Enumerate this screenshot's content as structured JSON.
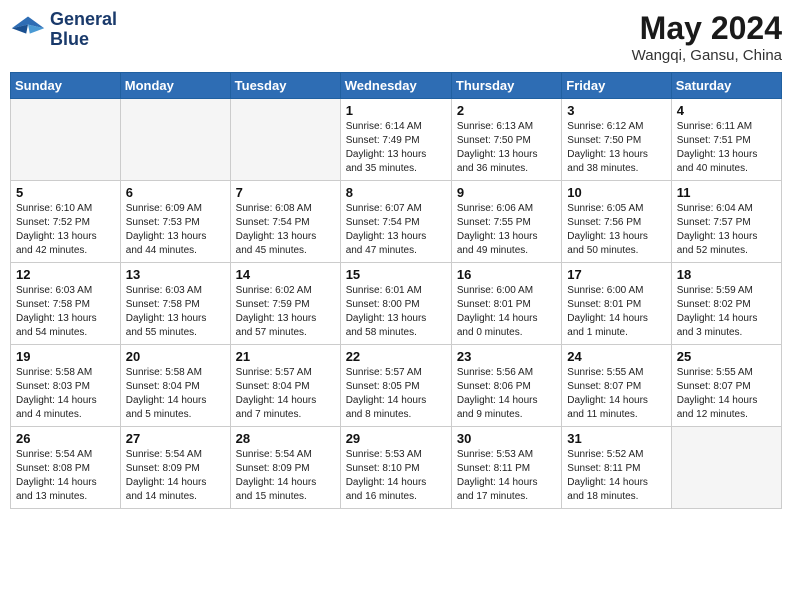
{
  "header": {
    "logo_line1": "General",
    "logo_line2": "Blue",
    "month_year": "May 2024",
    "location": "Wangqi, Gansu, China"
  },
  "days_of_week": [
    "Sunday",
    "Monday",
    "Tuesday",
    "Wednesday",
    "Thursday",
    "Friday",
    "Saturday"
  ],
  "weeks": [
    [
      {
        "day": "",
        "info": ""
      },
      {
        "day": "",
        "info": ""
      },
      {
        "day": "",
        "info": ""
      },
      {
        "day": "1",
        "info": "Sunrise: 6:14 AM\nSunset: 7:49 PM\nDaylight: 13 hours\nand 35 minutes."
      },
      {
        "day": "2",
        "info": "Sunrise: 6:13 AM\nSunset: 7:50 PM\nDaylight: 13 hours\nand 36 minutes."
      },
      {
        "day": "3",
        "info": "Sunrise: 6:12 AM\nSunset: 7:50 PM\nDaylight: 13 hours\nand 38 minutes."
      },
      {
        "day": "4",
        "info": "Sunrise: 6:11 AM\nSunset: 7:51 PM\nDaylight: 13 hours\nand 40 minutes."
      }
    ],
    [
      {
        "day": "5",
        "info": "Sunrise: 6:10 AM\nSunset: 7:52 PM\nDaylight: 13 hours\nand 42 minutes."
      },
      {
        "day": "6",
        "info": "Sunrise: 6:09 AM\nSunset: 7:53 PM\nDaylight: 13 hours\nand 44 minutes."
      },
      {
        "day": "7",
        "info": "Sunrise: 6:08 AM\nSunset: 7:54 PM\nDaylight: 13 hours\nand 45 minutes."
      },
      {
        "day": "8",
        "info": "Sunrise: 6:07 AM\nSunset: 7:54 PM\nDaylight: 13 hours\nand 47 minutes."
      },
      {
        "day": "9",
        "info": "Sunrise: 6:06 AM\nSunset: 7:55 PM\nDaylight: 13 hours\nand 49 minutes."
      },
      {
        "day": "10",
        "info": "Sunrise: 6:05 AM\nSunset: 7:56 PM\nDaylight: 13 hours\nand 50 minutes."
      },
      {
        "day": "11",
        "info": "Sunrise: 6:04 AM\nSunset: 7:57 PM\nDaylight: 13 hours\nand 52 minutes."
      }
    ],
    [
      {
        "day": "12",
        "info": "Sunrise: 6:03 AM\nSunset: 7:58 PM\nDaylight: 13 hours\nand 54 minutes."
      },
      {
        "day": "13",
        "info": "Sunrise: 6:03 AM\nSunset: 7:58 PM\nDaylight: 13 hours\nand 55 minutes."
      },
      {
        "day": "14",
        "info": "Sunrise: 6:02 AM\nSunset: 7:59 PM\nDaylight: 13 hours\nand 57 minutes."
      },
      {
        "day": "15",
        "info": "Sunrise: 6:01 AM\nSunset: 8:00 PM\nDaylight: 13 hours\nand 58 minutes."
      },
      {
        "day": "16",
        "info": "Sunrise: 6:00 AM\nSunset: 8:01 PM\nDaylight: 14 hours\nand 0 minutes."
      },
      {
        "day": "17",
        "info": "Sunrise: 6:00 AM\nSunset: 8:01 PM\nDaylight: 14 hours\nand 1 minute."
      },
      {
        "day": "18",
        "info": "Sunrise: 5:59 AM\nSunset: 8:02 PM\nDaylight: 14 hours\nand 3 minutes."
      }
    ],
    [
      {
        "day": "19",
        "info": "Sunrise: 5:58 AM\nSunset: 8:03 PM\nDaylight: 14 hours\nand 4 minutes."
      },
      {
        "day": "20",
        "info": "Sunrise: 5:58 AM\nSunset: 8:04 PM\nDaylight: 14 hours\nand 5 minutes."
      },
      {
        "day": "21",
        "info": "Sunrise: 5:57 AM\nSunset: 8:04 PM\nDaylight: 14 hours\nand 7 minutes."
      },
      {
        "day": "22",
        "info": "Sunrise: 5:57 AM\nSunset: 8:05 PM\nDaylight: 14 hours\nand 8 minutes."
      },
      {
        "day": "23",
        "info": "Sunrise: 5:56 AM\nSunset: 8:06 PM\nDaylight: 14 hours\nand 9 minutes."
      },
      {
        "day": "24",
        "info": "Sunrise: 5:55 AM\nSunset: 8:07 PM\nDaylight: 14 hours\nand 11 minutes."
      },
      {
        "day": "25",
        "info": "Sunrise: 5:55 AM\nSunset: 8:07 PM\nDaylight: 14 hours\nand 12 minutes."
      }
    ],
    [
      {
        "day": "26",
        "info": "Sunrise: 5:54 AM\nSunset: 8:08 PM\nDaylight: 14 hours\nand 13 minutes."
      },
      {
        "day": "27",
        "info": "Sunrise: 5:54 AM\nSunset: 8:09 PM\nDaylight: 14 hours\nand 14 minutes."
      },
      {
        "day": "28",
        "info": "Sunrise: 5:54 AM\nSunset: 8:09 PM\nDaylight: 14 hours\nand 15 minutes."
      },
      {
        "day": "29",
        "info": "Sunrise: 5:53 AM\nSunset: 8:10 PM\nDaylight: 14 hours\nand 16 minutes."
      },
      {
        "day": "30",
        "info": "Sunrise: 5:53 AM\nSunset: 8:11 PM\nDaylight: 14 hours\nand 17 minutes."
      },
      {
        "day": "31",
        "info": "Sunrise: 5:52 AM\nSunset: 8:11 PM\nDaylight: 14 hours\nand 18 minutes."
      },
      {
        "day": "",
        "info": ""
      }
    ]
  ]
}
